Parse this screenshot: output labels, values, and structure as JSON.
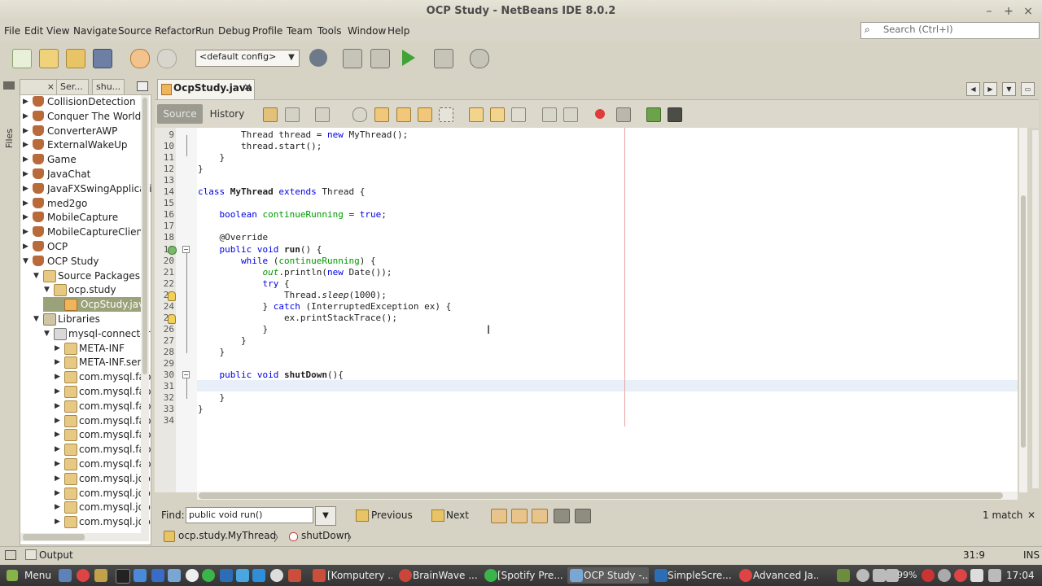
{
  "window": {
    "title": "OCP Study - NetBeans IDE 8.0.2",
    "min": "–",
    "max": "+",
    "close": "×"
  },
  "menu": [
    "File",
    "Edit",
    "View",
    "Navigate",
    "Source",
    "Refactor",
    "Run",
    "Debug",
    "Profile",
    "Team",
    "Tools",
    "Window",
    "Help"
  ],
  "search": {
    "placeholder": "Search (Ctrl+I)"
  },
  "toolbar": {
    "config": "<default config>"
  },
  "side_rail": {
    "files_tab": "Files"
  },
  "projects_panel": {
    "tabs": [
      "",
      "Ser...",
      "shu..."
    ],
    "tree": [
      {
        "label": "CollisionDetection",
        "depth": 0,
        "arrow": "▶",
        "icon": "proj-cup"
      },
      {
        "label": "Conquer The World",
        "depth": 0,
        "arrow": "▶",
        "icon": "proj-cup"
      },
      {
        "label": "ConverterAWP",
        "depth": 0,
        "arrow": "▶",
        "icon": "proj-cup"
      },
      {
        "label": "ExternalWakeUp",
        "depth": 0,
        "arrow": "▶",
        "icon": "proj-cup"
      },
      {
        "label": "Game",
        "depth": 0,
        "arrow": "▶",
        "icon": "proj-cup"
      },
      {
        "label": "JavaChat",
        "depth": 0,
        "arrow": "▶",
        "icon": "proj-cup"
      },
      {
        "label": "JavaFXSwingApplicati",
        "depth": 0,
        "arrow": "▶",
        "icon": "proj-cup"
      },
      {
        "label": "med2go",
        "depth": 0,
        "arrow": "▶",
        "icon": "proj-cup"
      },
      {
        "label": "MobileCapture",
        "depth": 0,
        "arrow": "▶",
        "icon": "proj-cup"
      },
      {
        "label": "MobileCaptureClient",
        "depth": 0,
        "arrow": "▶",
        "icon": "proj-cup"
      },
      {
        "label": "OCP",
        "depth": 0,
        "arrow": "▶",
        "icon": "proj-cup"
      },
      {
        "label": "OCP Study",
        "depth": 0,
        "arrow": "▼",
        "icon": "proj-cup"
      },
      {
        "label": "Source Packages",
        "depth": 1,
        "arrow": "▼",
        "icon": "pkg"
      },
      {
        "label": "ocp.study",
        "depth": 2,
        "arrow": "▼",
        "icon": "pkg"
      },
      {
        "label": "OcpStudy.java",
        "depth": 3,
        "arrow": "",
        "icon": "java",
        "selected": true
      },
      {
        "label": "Libraries",
        "depth": 1,
        "arrow": "▼",
        "icon": "lib"
      },
      {
        "label": "mysql-connector",
        "depth": 2,
        "arrow": "▼",
        "icon": "jar"
      },
      {
        "label": "META-INF",
        "depth": 3,
        "arrow": "▶",
        "icon": "pkg"
      },
      {
        "label": "META-INF.ser",
        "depth": 3,
        "arrow": "▶",
        "icon": "pkg"
      },
      {
        "label": "com.mysql.fab",
        "depth": 3,
        "arrow": "▶",
        "icon": "pkg"
      },
      {
        "label": "com.mysql.fab",
        "depth": 3,
        "arrow": "▶",
        "icon": "pkg"
      },
      {
        "label": "com.mysql.fab",
        "depth": 3,
        "arrow": "▶",
        "icon": "pkg"
      },
      {
        "label": "com.mysql.fab",
        "depth": 3,
        "arrow": "▶",
        "icon": "pkg"
      },
      {
        "label": "com.mysql.fab",
        "depth": 3,
        "arrow": "▶",
        "icon": "pkg"
      },
      {
        "label": "com.mysql.fab",
        "depth": 3,
        "arrow": "▶",
        "icon": "pkg"
      },
      {
        "label": "com.mysql.fab",
        "depth": 3,
        "arrow": "▶",
        "icon": "pkg"
      },
      {
        "label": "com.mysql.jdb",
        "depth": 3,
        "arrow": "▶",
        "icon": "pkg"
      },
      {
        "label": "com.mysql.jdb",
        "depth": 3,
        "arrow": "▶",
        "icon": "pkg"
      },
      {
        "label": "com.mysql.jdb",
        "depth": 3,
        "arrow": "▶",
        "icon": "pkg"
      },
      {
        "label": "com.mysql.jdb",
        "depth": 3,
        "arrow": "▶",
        "icon": "pkg"
      }
    ]
  },
  "editor": {
    "tab_label": "OcpStudy.java",
    "source_label": "Source",
    "history_label": "History",
    "lines": [
      {
        "n": "9",
        "html": "        Thread thread = <span class=\"kw\">new</span> MyThread();"
      },
      {
        "n": "10",
        "html": "        thread.start();"
      },
      {
        "n": "11",
        "html": "    }"
      },
      {
        "n": "12",
        "html": "}"
      },
      {
        "n": "13",
        "html": ""
      },
      {
        "n": "14",
        "html": "<span class=\"kw\">class</span> <span class=\"bold\">MyThread</span> <span class=\"kw\">extends</span> Thread {"
      },
      {
        "n": "15",
        "html": ""
      },
      {
        "n": "16",
        "html": "    <span class=\"kw\">boolean</span> <span class=\"fld\">continueRunning</span> = <span class=\"kw\">true</span>;"
      },
      {
        "n": "17",
        "html": ""
      },
      {
        "n": "18",
        "html": "    @Override"
      },
      {
        "n": "19",
        "html": "    <span class=\"kw\">public void</span> <span class=\"bold\">run</span>() {"
      },
      {
        "n": "20",
        "html": "        <span class=\"kw\">while</span> (<span class=\"fld\">continueRunning</span>) {"
      },
      {
        "n": "21",
        "html": "            <span class=\"ital\">out</span>.println(<span class=\"kw\">new</span> Date());"
      },
      {
        "n": "22",
        "html": "            <span class=\"kw\">try</span> {"
      },
      {
        "n": "23",
        "html": "                Thread.<span class=\"sm\">sleep</span>(1000);"
      },
      {
        "n": "24",
        "html": "            } <span class=\"kw\">catch</span> (InterruptedException ex) {"
      },
      {
        "n": "25",
        "html": "                ex.printStackTrace();"
      },
      {
        "n": "26",
        "html": "            }"
      },
      {
        "n": "27",
        "html": "        }"
      },
      {
        "n": "28",
        "html": "    }"
      },
      {
        "n": "29",
        "html": ""
      },
      {
        "n": "30",
        "html": "    <span class=\"kw\">public void</span> <span class=\"bold\">shutDown</span>(){"
      },
      {
        "n": "31",
        "html": ""
      },
      {
        "n": "32",
        "html": "    }"
      },
      {
        "n": "33",
        "html": "}"
      },
      {
        "n": "34",
        "html": ""
      }
    ]
  },
  "find": {
    "label": "Find:",
    "value": "public void run()",
    "previous": "Previous",
    "next": "Next",
    "match_count": "1 match"
  },
  "breadcrumb": [
    "ocp.study.MyThread",
    "shutDown"
  ],
  "output": {
    "label": "Output"
  },
  "status": {
    "position": "31:9",
    "mode": "INS"
  },
  "taskbar": {
    "menu": "Menu",
    "items": [
      "[Komputery ...",
      "BrainWave ...",
      "[Spotify Pre...",
      "OCP Study -...",
      "SimpleScre...",
      "Advanced Ja..."
    ],
    "battery": "99%",
    "clock": "17:04"
  },
  "colors": {
    "accent": "#9aa27a",
    "keyword": "#0000e6",
    "field": "#009900"
  }
}
